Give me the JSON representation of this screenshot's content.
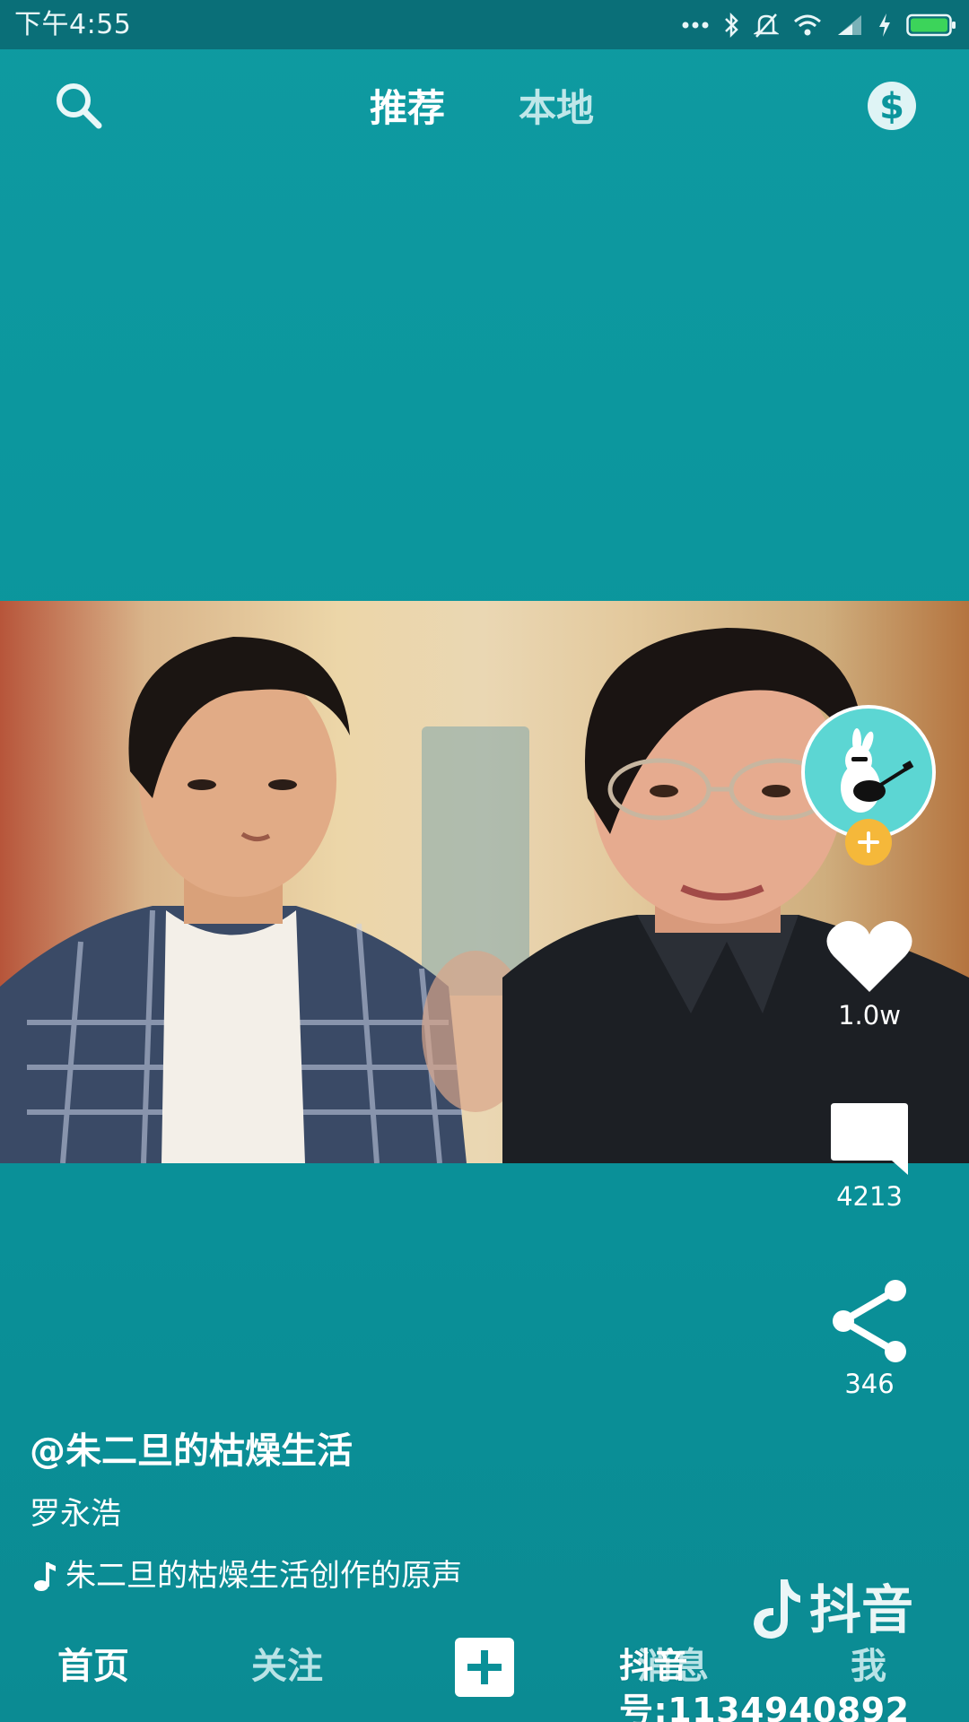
{
  "status_bar": {
    "time": "下午4:55",
    "icons": [
      "more-dots-icon",
      "bluetooth-icon",
      "mute-bell-icon",
      "wifi-icon",
      "signal-icon",
      "charging-icon",
      "battery-icon"
    ]
  },
  "top_nav": {
    "search_icon": "search-icon",
    "tabs": [
      {
        "label": "推荐",
        "active": true
      },
      {
        "label": "本地",
        "active": false
      }
    ],
    "coin_icon": "dollar-coin-icon"
  },
  "video": {
    "author": "@朱二旦的枯燥生活",
    "description": "罗永浩",
    "music": "朱二旦的枯燥生活创作的原声"
  },
  "actions": {
    "likes": "1.0w",
    "comments": "4213",
    "shares": "346"
  },
  "watermark": {
    "brand": "抖音",
    "id_text": "抖音号:1134940892"
  },
  "bottom_nav": {
    "items": [
      {
        "label": "首页",
        "active": true
      },
      {
        "label": "关注",
        "active": false
      },
      {
        "label": "消息",
        "active": false
      },
      {
        "label": "我",
        "active": false
      }
    ]
  },
  "colors": {
    "background": "#0b959c",
    "status_bar": "#0a6f78",
    "follow_badge": "#f5b83a",
    "avatar_bg": "#5cd6d3",
    "inactive_text": "#b9e3e6"
  }
}
